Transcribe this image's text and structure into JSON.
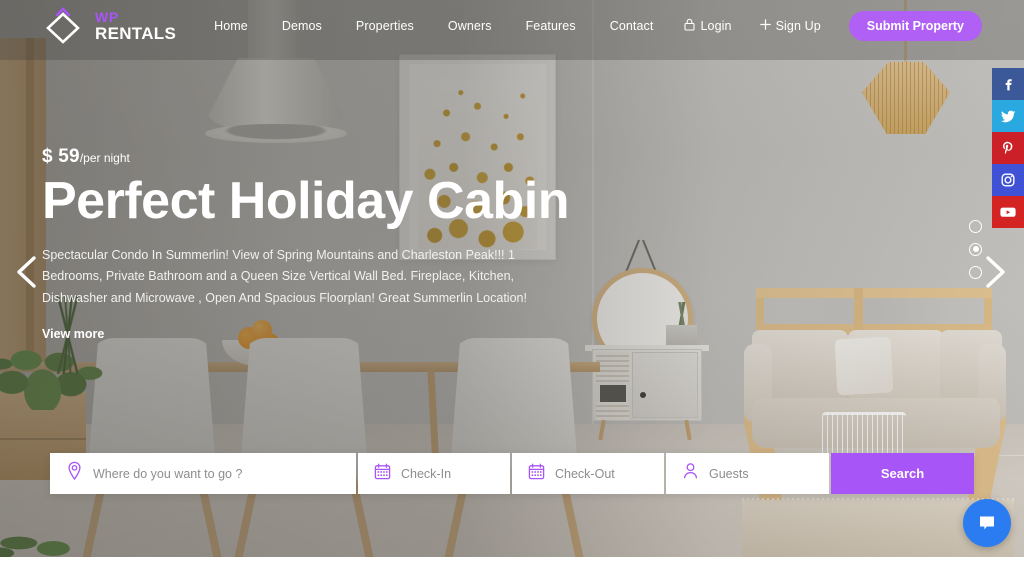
{
  "brand": {
    "logo_icon": "diamond-logo-icon",
    "name_primary": "WP",
    "name_secondary": "RENTALS",
    "accent_color": "#a855f7"
  },
  "header": {
    "nav_items": [
      {
        "label": "Home",
        "icon": null
      },
      {
        "label": "Demos",
        "icon": null
      },
      {
        "label": "Properties",
        "icon": null
      },
      {
        "label": "Owners",
        "icon": null
      },
      {
        "label": "Features",
        "icon": null
      },
      {
        "label": "Contact",
        "icon": null
      }
    ],
    "auth": [
      {
        "label": "Login",
        "icon": "lock-icon"
      },
      {
        "label": "Sign Up",
        "icon": "plus-icon"
      }
    ],
    "submit_button": {
      "label": "Submit Property",
      "color": "#b060f5"
    }
  },
  "hero": {
    "price_currency": "$",
    "price_amount": "59",
    "price_unit": "/per night",
    "title": "Perfect Holiday Cabin",
    "description": "Spectacular Condo In Summerlin! View of Spring Mountains and Charleston Peak!!! 1 Bedrooms, Private Bathroom and a Queen Size Vertical Wall Bed. Fireplace, Kitchen, Dishwasher and Microwave , Open And Spacious Floorplan! Great Summerlin Location!",
    "view_more_label": "View more",
    "prev_arrow_icon": "chevron-left-icon",
    "next_arrow_icon": "chevron-right-icon",
    "slides_total": 3,
    "slide_active_index": 2
  },
  "search": {
    "destination_placeholder": "Where do you want to go ?",
    "destination_value": "",
    "destination_icon": "map-pin-icon",
    "checkin_placeholder": "Check-In",
    "checkin_value": "",
    "checkin_icon": "calendar-icon",
    "checkout_placeholder": "Check-Out",
    "checkout_value": "",
    "checkout_icon": "calendar-icon",
    "guests_placeholder": "Guests",
    "guests_value": "",
    "guests_icon": "user-icon",
    "search_button_label": "Search",
    "search_button_color": "#a855f7"
  },
  "social": [
    {
      "name": "Facebook",
      "icon": "facebook-icon",
      "color": "#3b5998"
    },
    {
      "name": "Twitter",
      "icon": "twitter-icon",
      "color": "#2aa9e0"
    },
    {
      "name": "Pinterest",
      "icon": "pinterest-icon",
      "color": "#cb2027"
    },
    {
      "name": "Instagram",
      "icon": "instagram-icon",
      "color": "#3f51d5"
    },
    {
      "name": "YouTube",
      "icon": "youtube-icon",
      "color": "#d32323"
    }
  ],
  "chat": {
    "icon": "chat-bubble-icon",
    "color": "#2a7cf0"
  }
}
